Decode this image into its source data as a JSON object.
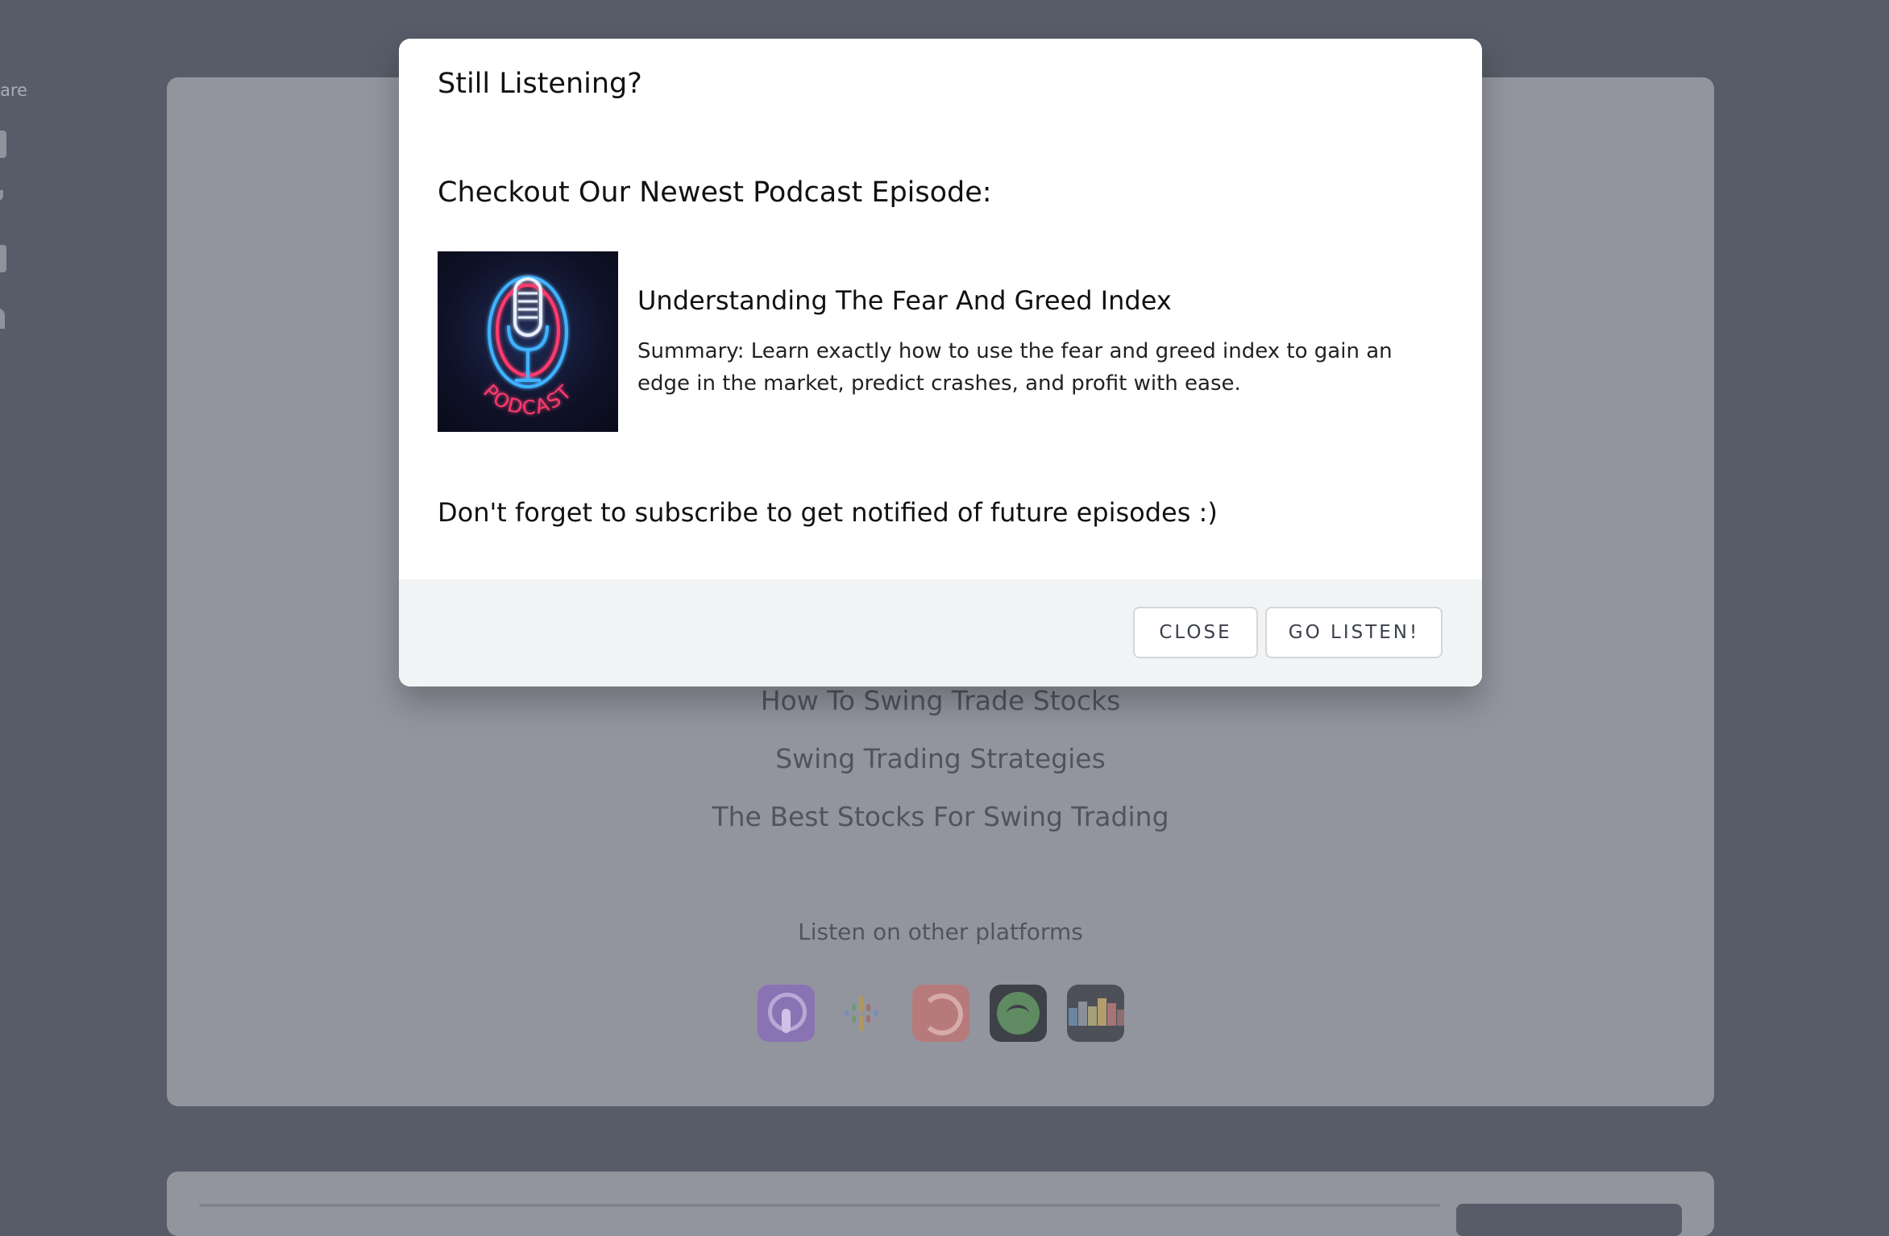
{
  "share_sidebar": {
    "label": "are"
  },
  "background": {
    "links": [
      "How To Swing Trade Stocks",
      "Swing Trading Strategies",
      "The Best Stocks For Swing Trading"
    ],
    "listen_label": "Listen on other platforms",
    "platforms": [
      "apple-podcasts",
      "google-podcasts",
      "pocket-casts",
      "spotify",
      "castbox"
    ]
  },
  "modal": {
    "title": "Still Listening?",
    "subtitle": "Checkout Our Newest Podcast Episode:",
    "cover_text": "PODCAST",
    "episode_title": "Understanding The Fear And Greed Index",
    "episode_summary": "Summary: Learn exactly how to use the fear and greed index to gain an edge in the market, predict crashes, and profit with ease.",
    "subscribe_note": "Don't forget to subscribe to get notified of future episodes :)",
    "close_label": "CLOSE",
    "listen_label": "GO LISTEN!"
  }
}
